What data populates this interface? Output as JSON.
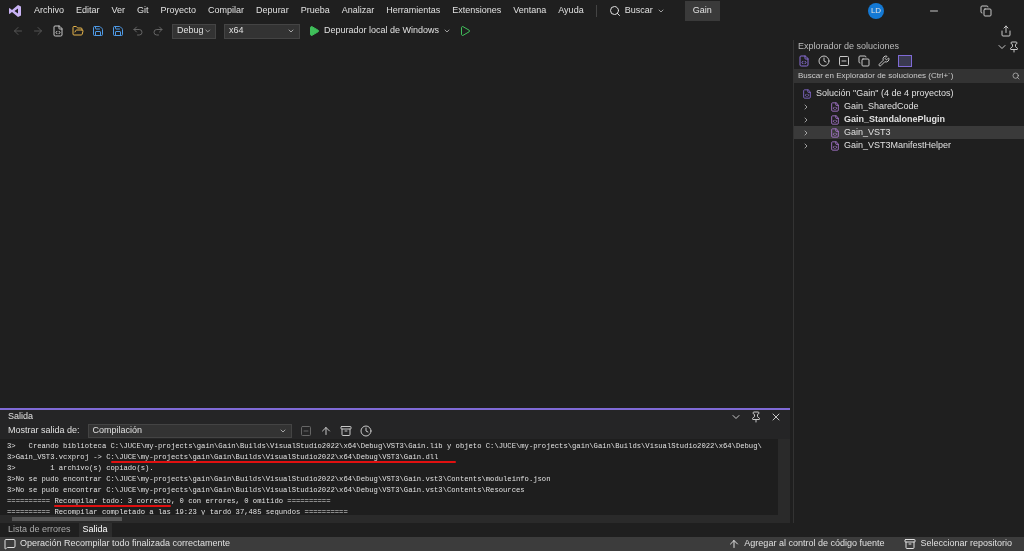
{
  "menu": [
    "Archivo",
    "Editar",
    "Ver",
    "Git",
    "Proyecto",
    "Compilar",
    "Depurar",
    "Prueba",
    "Analizar",
    "Herramientas",
    "Extensiones",
    "Ventana",
    "Ayuda"
  ],
  "search": "Buscar",
  "solution_name": "Gain",
  "avatar": "LD",
  "toolbar": {
    "configuration": "Debug",
    "platform": "x64",
    "run": "Depurador local de Windows"
  },
  "solution_explorer": {
    "title": "Explorador de soluciones",
    "search_placeholder": "Buscar en Explorador de soluciones (Ctrl+´)",
    "root": "Solución \"Gain\"  (4 de 4 proyectos)",
    "projects": [
      {
        "name": "Gain_SharedCode",
        "startup": false,
        "selected": false
      },
      {
        "name": "Gain_StandalonePlugin",
        "startup": true,
        "selected": false
      },
      {
        "name": "Gain_VST3",
        "startup": false,
        "selected": true
      },
      {
        "name": "Gain_VST3ManifestHelper",
        "startup": false,
        "selected": false
      }
    ]
  },
  "output": {
    "title": "Salida",
    "source_label": "Mostrar salida de:",
    "source": "Compilación",
    "lines": [
      "3>   Creando biblioteca C:\\JUCE\\my-projects\\gain\\Gain\\Builds\\VisualStudio2022\\x64\\Debug\\VST3\\Gain.lib y objeto C:\\JUCE\\my-projects\\gain\\Gain\\Builds\\VisualStudio2022\\x64\\Debug\\",
      "3>Gain_VST3.vcxproj -> C:\\JUCE\\my-projects\\gain\\Gain\\Builds\\VisualStudio2022\\x64\\Debug\\VST3\\Gain.dll",
      "3>        1 archivo(s) copiado(s).",
      "3>No se pudo encontrar C:\\JUCE\\my-projects\\gain\\Gain\\Builds\\VisualStudio2022\\x64\\Debug\\VST3\\Gain.vst3\\Contents\\moduleinfo.json",
      "3>No se pudo encontrar C:\\JUCE\\my-projects\\gain\\Gain\\Builds\\VisualStudio2022\\x64\\Debug\\VST3\\Gain.vst3\\Contents\\Resources",
      "========== Recompilar todo: 3 correcto, 0 con errores, 0 omitido ==========",
      "========== Recompilar completado a las 19:23 y tardó 37,485 segundos =========="
    ]
  },
  "bottom_tabs": [
    {
      "label": "Lista de errores",
      "selected": false
    },
    {
      "label": "Salida",
      "selected": true
    }
  ],
  "status_bar": {
    "message": "Operación Recompilar todo finalizada correctamente",
    "source_control": "Agregar al control de código fuente",
    "repository": "Seleccionar repositorio"
  }
}
